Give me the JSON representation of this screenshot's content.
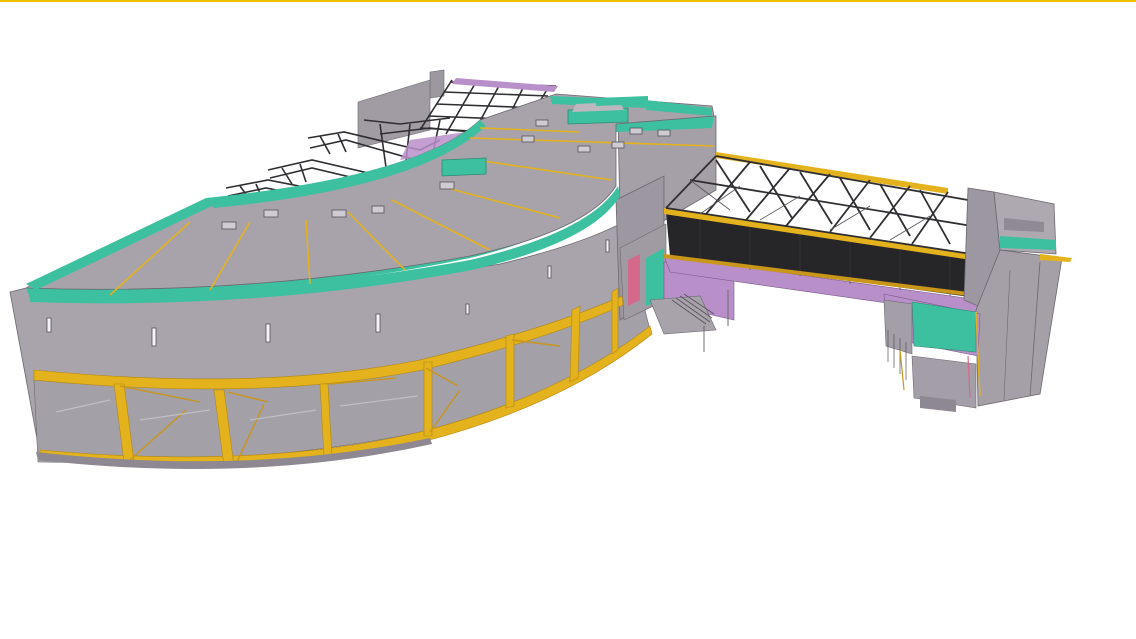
{
  "viewport": {
    "background": "#ffffff",
    "accent_line_color": "#f2c200"
  },
  "model": {
    "colors": {
      "concrete": "#a9a4ab",
      "concrete_dark": "#8d8891",
      "concrete_light": "#bdb8bf",
      "roof_edge": "#3cc0a0",
      "steel": "#e3b21c",
      "steel_dark": "#c9961a",
      "truss": "#2f2f33",
      "mesh": "#262629",
      "partition": "#b98fc9",
      "wall_accent": "#d46a8b",
      "bracing": "#bfbfc4"
    },
    "icons": []
  }
}
